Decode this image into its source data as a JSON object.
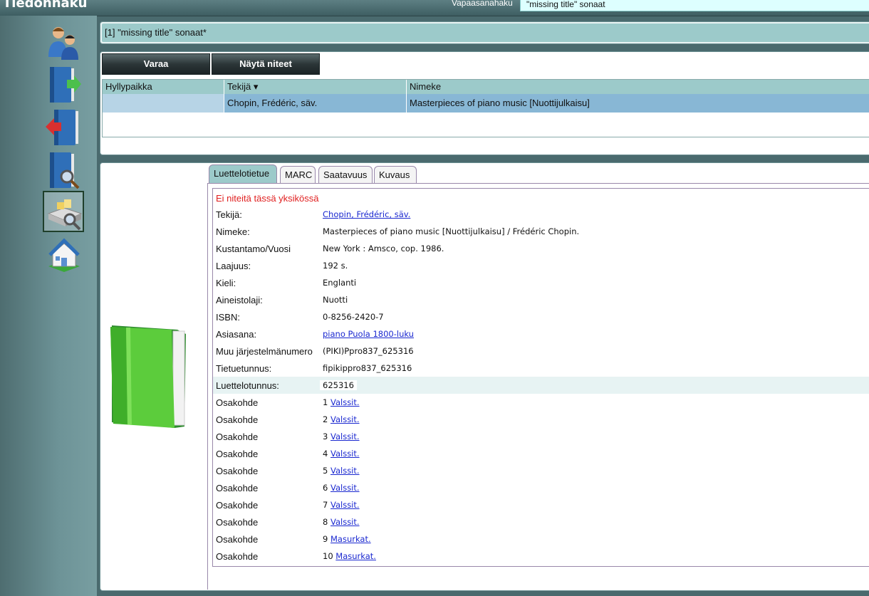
{
  "header": {
    "app_title": "Tiedonhaku",
    "search_label": "Vapaasanahaku",
    "search_value": "\"missing title\" sonaat"
  },
  "sidebar": {
    "items": [
      {
        "icon": "users-icon"
      },
      {
        "icon": "book-checkout-icon"
      },
      {
        "icon": "book-return-icon"
      },
      {
        "icon": "book-search-icon"
      },
      {
        "icon": "catalog-search-icon",
        "active": true
      },
      {
        "icon": "home-icon"
      }
    ]
  },
  "breadcrumb": "[1] \"missing title\" sonaat*",
  "toolbar": {
    "reserve_label": "Varaa",
    "show_items_label": "Näytä niteet"
  },
  "results": {
    "columns": [
      "Hyllypaikka",
      "Tekijä ▾",
      "Nimeke"
    ],
    "rows": [
      {
        "shelf": "",
        "author": "Chopin, Frédéric, säv.",
        "title": "Masterpieces of piano music [Nuottijulkaisu]"
      }
    ]
  },
  "tabs": [
    "Luettelotietue",
    "MARC",
    "Saatavuus",
    "Kuvaus"
  ],
  "record": {
    "warning": "Ei niteitä tässä yksikössä",
    "fields": [
      {
        "label": "Tekijä:",
        "value": "Chopin, Frédéric, säv.",
        "link": true
      },
      {
        "label": "Nimeke:",
        "value": "Masterpieces of piano music [Nuottijulkaisu] / Frédéric Chopin."
      },
      {
        "label": "Kustantamo/Vuosi",
        "value": "New York : Amsco, cop. 1986."
      },
      {
        "label": "Laajuus:",
        "value": "192 s."
      },
      {
        "label": "Kieli:",
        "value": "Englanti"
      },
      {
        "label": "Aineistolaji:",
        "value": "Nuotti"
      },
      {
        "label": "ISBN:",
        "value": "0-8256-2420-7"
      },
      {
        "label": "Asiasana:",
        "value": "piano Puola 1800-luku",
        "link": true
      },
      {
        "label": "Muu järjestelmänumero",
        "value": "(PIKI)Ppro837_625316"
      },
      {
        "label": "Tietuetunnus:",
        "value": "fipikippro837_625316"
      },
      {
        "label": "Luettelotunnus:",
        "value": "625316",
        "highlight": true
      }
    ],
    "parts": [
      {
        "label": "Osakohde",
        "num": "1",
        "title": "Valssit."
      },
      {
        "label": "Osakohde",
        "num": "2",
        "title": "Valssit."
      },
      {
        "label": "Osakohde",
        "num": "3",
        "title": "Valssit."
      },
      {
        "label": "Osakohde",
        "num": "4",
        "title": "Valssit."
      },
      {
        "label": "Osakohde",
        "num": "5",
        "title": "Valssit."
      },
      {
        "label": "Osakohde",
        "num": "6",
        "title": "Valssit."
      },
      {
        "label": "Osakohde",
        "num": "7",
        "title": "Valssit."
      },
      {
        "label": "Osakohde",
        "num": "8",
        "title": "Valssit."
      },
      {
        "label": "Osakohde",
        "num": "9",
        "title": "Masurkat."
      },
      {
        "label": "Osakohde",
        "num": "10",
        "title": "Masurkat."
      }
    ]
  },
  "colors": {
    "accent": "#9ccaca",
    "selected_row": "#88b7d5",
    "warning": "#e02020",
    "link": "#1a28d0"
  }
}
